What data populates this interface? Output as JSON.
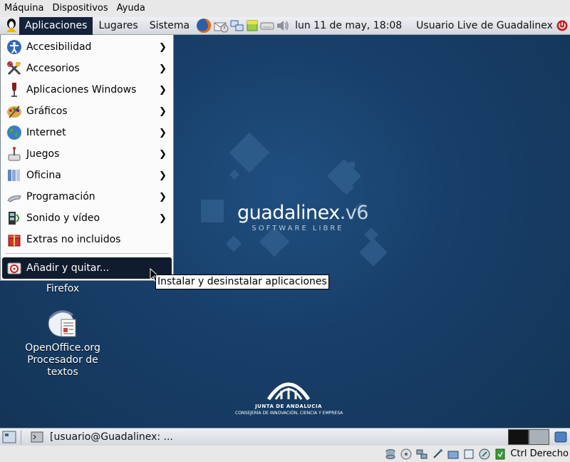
{
  "vbox_menubar": {
    "items": [
      "Máquina",
      "Dispositivos",
      "Ayuda"
    ]
  },
  "top_panel": {
    "menus": [
      "Aplicaciones",
      "Lugares",
      "Sistema"
    ],
    "clock": "lun 11 de may, 18:08",
    "user": "Usuario Live de Guadalinex"
  },
  "apps_menu": {
    "items": [
      {
        "label": "Accesibilidad",
        "icon": "accessibility-icon",
        "submenu": true
      },
      {
        "label": "Accesorios",
        "icon": "accessories-icon",
        "submenu": true
      },
      {
        "label": "Aplicaciones Windows",
        "icon": "wine-icon",
        "submenu": true
      },
      {
        "label": "Gráficos",
        "icon": "graphics-icon",
        "submenu": true
      },
      {
        "label": "Internet",
        "icon": "internet-globe-icon",
        "submenu": true
      },
      {
        "label": "Juegos",
        "icon": "games-icon",
        "submenu": true
      },
      {
        "label": "Oficina",
        "icon": "office-icon",
        "submenu": true
      },
      {
        "label": "Programación",
        "icon": "programming-icon",
        "submenu": true
      },
      {
        "label": "Sonido y vídeo",
        "icon": "multimedia-icon",
        "submenu": true
      },
      {
        "label": "Extras no incluidos",
        "icon": "extras-icon",
        "submenu": false
      }
    ],
    "add_remove": {
      "label": "Añadir y quitar...",
      "icon": "add-remove-icon"
    }
  },
  "tooltip": "Instalar y desinstalar aplicaciones",
  "desktop": {
    "icons": [
      {
        "label": "Firefox"
      },
      {
        "label": "OpenOffice.org\nProcesador de\ntextos"
      }
    ],
    "brand_main": "guadalinex",
    "brand_version": ".v6",
    "brand_sub": "SOFTWARE LIBRE",
    "junta_title": "JUNTA DE ANDALUCIA",
    "junta_sub": "CONSEJERÍA DE INNOVACIÓN, CIENCIA Y EMPRESA"
  },
  "bottom_panel": {
    "task": "[usuario@Guadalinex: ..."
  },
  "vbox_status": {
    "host_key": "Ctrl Derecho"
  },
  "colors": {
    "menu_highlight": "#101c2e",
    "desktop_bg": "#183f6a"
  }
}
